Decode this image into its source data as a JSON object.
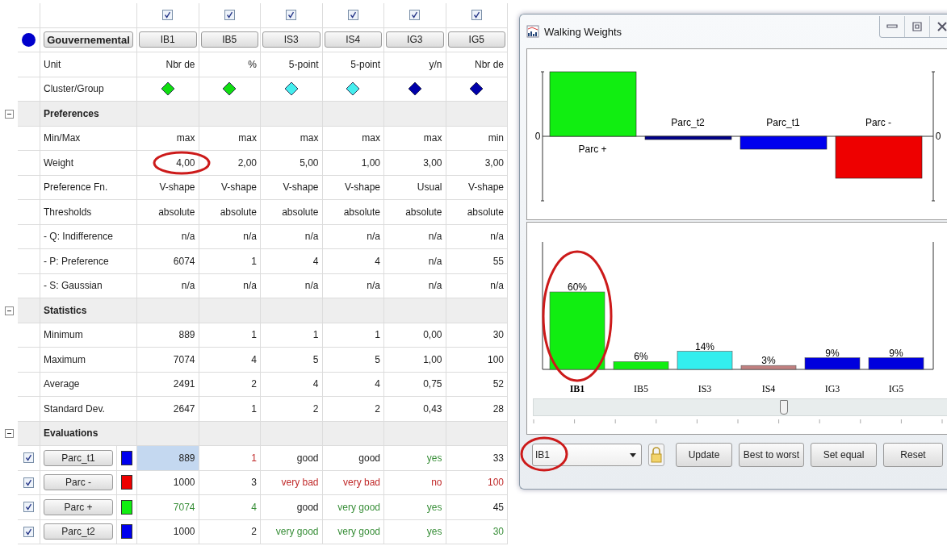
{
  "table": {
    "group": {
      "label": "Gouvernemental",
      "color": "#0000cc"
    },
    "columns": [
      {
        "label": "IB1",
        "checked": true
      },
      {
        "label": "IB5",
        "checked": true
      },
      {
        "label": "IS3",
        "checked": true
      },
      {
        "label": "IS4",
        "checked": true
      },
      {
        "label": "IG3",
        "checked": true
      },
      {
        "label": "IG5",
        "checked": true
      }
    ],
    "rows": [
      {
        "kind": "attribute",
        "label": "Unit",
        "cells": [
          "Nbr de",
          "%",
          "5-point",
          "5-point",
          "y/n",
          "Nbr de"
        ]
      },
      {
        "kind": "cluster",
        "label": "Cluster/Group",
        "cells": [
          {
            "color": "#11dd11"
          },
          {
            "color": "#11dd11"
          },
          {
            "color": "#44eeee"
          },
          {
            "color": "#44eeee"
          },
          {
            "color": "#0000aa"
          },
          {
            "color": "#0000aa"
          }
        ]
      },
      {
        "kind": "section",
        "label": "Preferences",
        "expanded": true
      },
      {
        "kind": "attribute",
        "label": "Min/Max",
        "cells": [
          "max",
          "max",
          "max",
          "max",
          "max",
          "min"
        ]
      },
      {
        "kind": "attribute",
        "label": "Weight",
        "cells": [
          {
            "text": "4,00",
            "circled": true
          },
          {
            "text": "2,00",
            "circled": false
          },
          {
            "text": "5,00",
            "circled": false
          },
          {
            "text": "1,00",
            "circled": false
          },
          {
            "text": "3,00",
            "circled": false
          },
          {
            "text": "3,00",
            "circled": false
          }
        ]
      },
      {
        "kind": "attribute",
        "label": "Preference Fn.",
        "cells": [
          "V-shape",
          "V-shape",
          "V-shape",
          "V-shape",
          "Usual",
          "V-shape"
        ]
      },
      {
        "kind": "attribute",
        "label": "Thresholds",
        "cells": [
          "absolute",
          "absolute",
          "absolute",
          "absolute",
          "absolute",
          "absolute"
        ]
      },
      {
        "kind": "attribute",
        "label": "- Q: Indifference",
        "cells": [
          "n/a",
          "n/a",
          "n/a",
          "n/a",
          "n/a",
          "n/a"
        ]
      },
      {
        "kind": "attribute",
        "label": "- P: Preference",
        "cells": [
          "6074",
          "1",
          "4",
          "4",
          "n/a",
          "55"
        ]
      },
      {
        "kind": "attribute",
        "label": "- S: Gaussian",
        "cells": [
          "n/a",
          "n/a",
          "n/a",
          "n/a",
          "n/a",
          "n/a"
        ]
      },
      {
        "kind": "section",
        "label": "Statistics",
        "expanded": true
      },
      {
        "kind": "attribute",
        "label": "Minimum",
        "cells": [
          "889",
          "1",
          "1",
          "1",
          "0,00",
          "30"
        ]
      },
      {
        "kind": "attribute",
        "label": "Maximum",
        "cells": [
          "7074",
          "4",
          "5",
          "5",
          "1,00",
          "100"
        ]
      },
      {
        "kind": "attribute",
        "label": "Average",
        "cells": [
          "2491",
          "2",
          "4",
          "4",
          "0,75",
          "52"
        ]
      },
      {
        "kind": "attribute",
        "label": "Standard Dev.",
        "cells": [
          "2647",
          "1",
          "2",
          "2",
          "0,43",
          "28"
        ]
      },
      {
        "kind": "section",
        "label": "Evaluations",
        "expanded": true
      },
      {
        "kind": "evaluation",
        "label": "Parc_t1",
        "checked": true,
        "color": "#0000ee",
        "cells": [
          {
            "text": "889",
            "color": "#222222",
            "selected": true
          },
          {
            "text": "1",
            "color": "#c02a2a",
            "selected": false
          },
          {
            "text": "good",
            "color": "#222222",
            "selected": false
          },
          {
            "text": "good",
            "color": "#222222",
            "selected": false
          },
          {
            "text": "yes",
            "color": "#3a8f3a",
            "selected": false
          },
          {
            "text": "33",
            "color": "#222222",
            "selected": false
          }
        ]
      },
      {
        "kind": "evaluation",
        "label": "Parc -",
        "checked": true,
        "color": "#ee0000",
        "cells": [
          {
            "text": "1000",
            "color": "#222222",
            "selected": false
          },
          {
            "text": "3",
            "color": "#222222",
            "selected": false
          },
          {
            "text": "very bad",
            "color": "#c02a2a",
            "selected": false
          },
          {
            "text": "very bad",
            "color": "#c02a2a",
            "selected": false
          },
          {
            "text": "no",
            "color": "#c02a2a",
            "selected": false
          },
          {
            "text": "100",
            "color": "#c02a2a",
            "selected": false
          }
        ]
      },
      {
        "kind": "evaluation",
        "label": "Parc +",
        "checked": true,
        "color": "#11ee11",
        "cells": [
          {
            "text": "7074",
            "color": "#3a8f3a",
            "selected": false
          },
          {
            "text": "4",
            "color": "#3a8f3a",
            "selected": false
          },
          {
            "text": "good",
            "color": "#222222",
            "selected": false
          },
          {
            "text": "very good",
            "color": "#3a8f3a",
            "selected": false
          },
          {
            "text": "yes",
            "color": "#3a8f3a",
            "selected": false
          },
          {
            "text": "45",
            "color": "#222222",
            "selected": false
          }
        ]
      },
      {
        "kind": "evaluation",
        "label": "Parc_t2",
        "checked": true,
        "color": "#0000ee",
        "cells": [
          {
            "text": "1000",
            "color": "#222222",
            "selected": false
          },
          {
            "text": "2",
            "color": "#222222",
            "selected": false
          },
          {
            "text": "very good",
            "color": "#3a8f3a",
            "selected": false
          },
          {
            "text": "very good",
            "color": "#3a8f3a",
            "selected": false
          },
          {
            "text": "yes",
            "color": "#3a8f3a",
            "selected": false
          },
          {
            "text": "30",
            "color": "#3a8f3a",
            "selected": false
          }
        ]
      }
    ]
  },
  "window": {
    "title": "Walking Weights",
    "flows_panel": {
      "left_zero_label": "0",
      "right_zero_label": "0",
      "bars": [
        {
          "label": "Parc +",
          "color": "#11ee11",
          "negative": false
        },
        {
          "label": "Parc_t2",
          "color": "#000088",
          "negative": true
        },
        {
          "label": "Parc_t1",
          "color": "#0000ee",
          "negative": true
        },
        {
          "label": "Parc -",
          "color": "#ee0000",
          "negative": true
        }
      ]
    },
    "weights_panel": {
      "chart_data": {
        "type": "bar",
        "categories": [
          "IB1",
          "IB5",
          "IS3",
          "IS4",
          "IG3",
          "IG5"
        ],
        "series": [
          {
            "values": [
              60,
              6,
              14,
              3,
              9,
              9
            ],
            "value_labels": [
              "60%",
              "6%",
              "14%",
              "3%",
              "9%",
              "9%"
            ]
          }
        ],
        "data_labels": true
      },
      "bars": [
        {
          "color": "#11ee11",
          "selected": true,
          "circled": true
        },
        {
          "color": "#11ee11",
          "selected": false,
          "circled": false
        },
        {
          "color": "#33eeee",
          "selected": false,
          "circled": false
        },
        {
          "color": "#c08080",
          "selected": false,
          "circled": false
        },
        {
          "color": "#0000dd",
          "selected": false,
          "circled": false
        },
        {
          "color": "#0000dd",
          "selected": false,
          "circled": false
        }
      ]
    },
    "slider": {
      "level": 0.6
    },
    "criterion_dropdown": {
      "value": "IB1",
      "circled": true
    },
    "buttons": [
      "Update",
      "Best to worst",
      "Set equal",
      "Reset"
    ]
  }
}
